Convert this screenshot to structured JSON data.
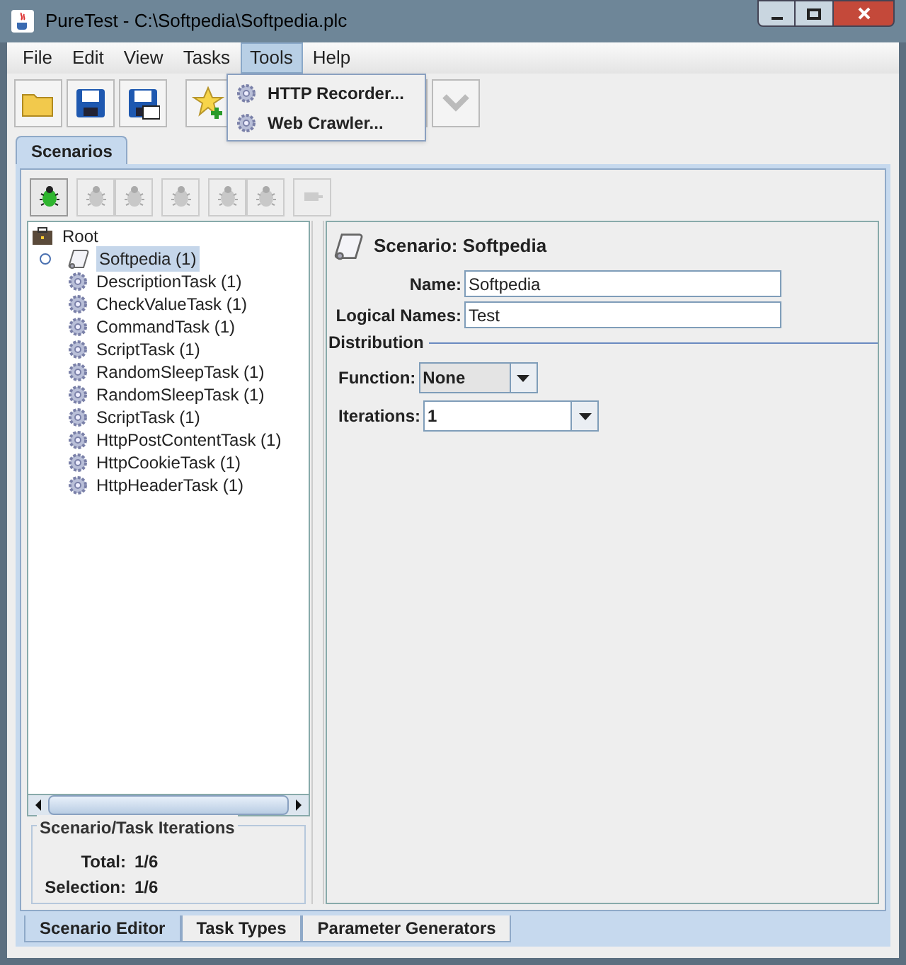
{
  "window": {
    "title": "PureTest - C:\\Softpedia\\Softpedia.plc"
  },
  "menu": [
    {
      "label": "File",
      "selected": false
    },
    {
      "label": "Edit",
      "selected": false
    },
    {
      "label": "View",
      "selected": false
    },
    {
      "label": "Tasks",
      "selected": false
    },
    {
      "label": "Tools",
      "selected": true
    },
    {
      "label": "Help",
      "selected": false
    }
  ],
  "open_menu": {
    "items": [
      "HTTP Recorder...",
      "Web Crawler..."
    ]
  },
  "tabs": [
    {
      "label": "Scenarios",
      "selected": true
    }
  ],
  "tree": {
    "label": "Root",
    "children": [
      {
        "label": "Softpedia (1)",
        "selected": true,
        "children": [
          {
            "label": "DescriptionTask (1)",
            "selected": false
          },
          {
            "label": "CheckValueTask (1)",
            "selected": false
          },
          {
            "label": "CommandTask (1)",
            "selected": false
          },
          {
            "label": "ScriptTask (1)",
            "selected": false
          },
          {
            "label": "RandomSleepTask (1)",
            "selected": false
          },
          {
            "label": "RandomSleepTask (1)",
            "selected": false
          },
          {
            "label": "ScriptTask (1)",
            "selected": false
          },
          {
            "label": "HttpPostContentTask (1)",
            "selected": false
          },
          {
            "label": "HttpCookieTask (1)",
            "selected": false
          },
          {
            "label": "HttpHeaderTask (1)",
            "selected": false
          }
        ]
      }
    ]
  },
  "iterations": {
    "title": "Scenario/Task Iterations",
    "rows": [
      {
        "label": "Total:",
        "value": "1/6"
      },
      {
        "label": "Selection:",
        "value": "1/6"
      }
    ]
  },
  "scenario": {
    "title": "Scenario: Softpedia",
    "fields": [
      {
        "label": "Name:",
        "value": "Softpedia"
      },
      {
        "label": "Logical Names:",
        "value": "Test"
      }
    ],
    "distribution": {
      "title": "Distribution",
      "function": {
        "label": "Function:",
        "value": "None"
      },
      "iterations": {
        "label": "Iterations:",
        "value": "1"
      }
    }
  },
  "bottom_tabs": [
    {
      "label": "Scenario Editor",
      "selected": true
    },
    {
      "label": "Task Types",
      "selected": false
    },
    {
      "label": "Parameter Generators",
      "selected": false
    }
  ]
}
